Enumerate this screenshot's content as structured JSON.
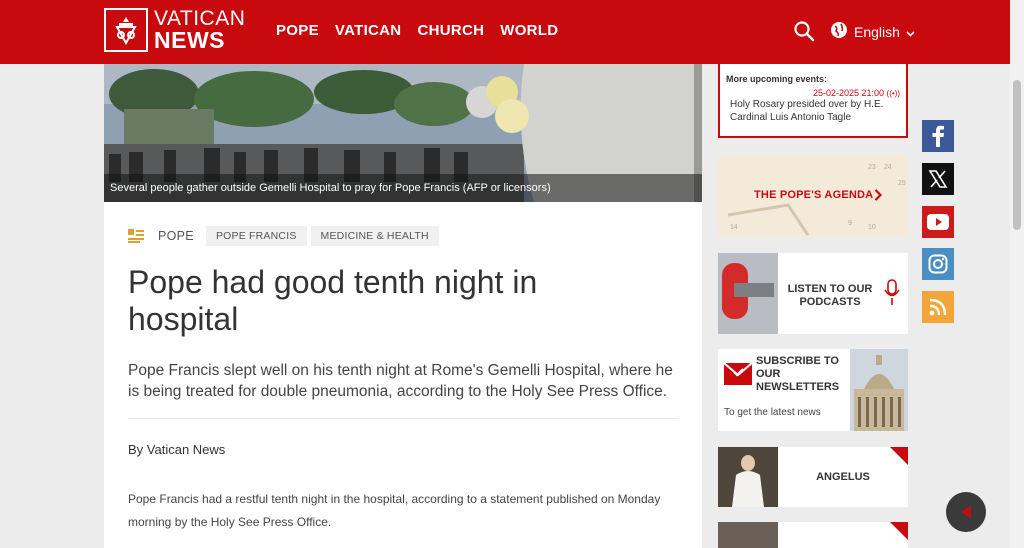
{
  "logo": {
    "line1": "VATICAN",
    "line2": "NEWS"
  },
  "nav": {
    "items": [
      "POPE",
      "VATICAN",
      "CHURCH",
      "WORLD"
    ]
  },
  "header": {
    "language": "English"
  },
  "hero": {
    "caption": "Several people gather outside Gemelli Hospital to pray for Pope Francis  (AFP or licensors)"
  },
  "article": {
    "category": "POPE",
    "tags": [
      "POPE FRANCIS",
      "MEDICINE & HEALTH"
    ],
    "title": "Pope had good tenth night in hospital",
    "lead": "Pope Francis slept well on his tenth night at Rome's Gemelli Hospital, where he is being treated for double pneumonia, according to the Holy See Press Office.",
    "byline": "By Vatican News",
    "body": "Pope Francis had a restful tenth night in the hospital, according to a statement published on Monday morning by the Holy See Press Office."
  },
  "sidebar": {
    "events": {
      "heading": "More upcoming events:",
      "date": "25-02-2025 21:00",
      "description": "Holy Rosary presided over by H.E. Cardinal Luis Antonio Tagle"
    },
    "agenda": {
      "label": "THE POPE'S AGENDA"
    },
    "podcasts": {
      "label": "LISTEN TO OUR PODCASTS"
    },
    "newsletter": {
      "label": "SUBSCRIBE TO OUR NEWSLETTERS",
      "sub": "To get the latest news"
    },
    "angelus": {
      "label": "ANGELUS"
    }
  },
  "social": {
    "items": [
      "facebook-icon",
      "x-icon",
      "youtube-icon",
      "instagram-icon",
      "rss-icon"
    ],
    "colors": {
      "facebook": "#3b5998",
      "x": "#111111",
      "youtube": "#cc1b1b",
      "instagram": "#4a8fc2",
      "rss": "#f4a53a"
    }
  },
  "colors": {
    "brand_red": "#c8090e"
  }
}
